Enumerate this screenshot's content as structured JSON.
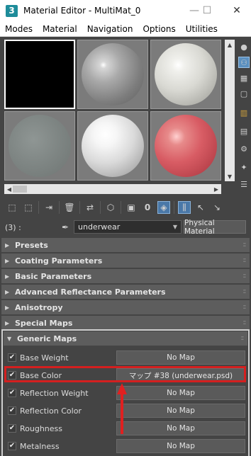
{
  "window": {
    "app_icon": "3",
    "title": "Material Editor - MultiMat_0",
    "minimize": "—",
    "maximize": "☐",
    "close": "✕"
  },
  "menu": [
    "Modes",
    "Material",
    "Navigation",
    "Options",
    "Utilities"
  ],
  "slots": [
    {
      "kind": "active-black"
    },
    {
      "kind": "grey-sphere"
    },
    {
      "kind": "white-sphere-soft"
    },
    {
      "kind": "noise-sphere"
    },
    {
      "kind": "white-sphere-glossy"
    },
    {
      "kind": "red-sphere"
    }
  ],
  "side_tools": [
    "sphere-icon",
    "sample-uv-icon",
    "checker-background-icon",
    "backlight-icon",
    "color-check-icon",
    "video-check-icon",
    "make-preview-icon",
    "options-icon"
  ],
  "toolbar_icons": [
    "get-material-icon",
    "put-to-scene-icon",
    "assign-to-selection-icon",
    "reset-map-icon",
    "make-unique-icon",
    "put-to-library-icon",
    "material-id-channel-icon",
    "show-shaded-icon",
    "show-end-result-icon",
    "go-to-parent-icon",
    "go-forward-to-sibling-icon"
  ],
  "material": {
    "id_label": "(3) :",
    "name": "underwear",
    "type": "Physical Material"
  },
  "rollouts": [
    "Presets",
    "Coating Parameters",
    "Basic Parameters",
    "Advanced Reflectance Parameters",
    "Anisotropy",
    "Special Maps",
    "Generic Maps"
  ],
  "generic_maps": [
    {
      "label": "Base Weight",
      "value": "No Map",
      "checked": true
    },
    {
      "label": "Base Color",
      "value": "マップ #38 (underwear.psd)",
      "checked": true
    },
    {
      "label": "Reflection Weight",
      "value": "No Map",
      "checked": true
    },
    {
      "label": "Reflection Color",
      "value": "No Map",
      "checked": true
    },
    {
      "label": "Roughness",
      "value": "No Map",
      "checked": true
    },
    {
      "label": "Metalness",
      "value": "No Map",
      "checked": true
    }
  ],
  "colors": {
    "highlight": "#d41f1f",
    "panel": "#444444",
    "rollout": "#5d5d5d"
  }
}
